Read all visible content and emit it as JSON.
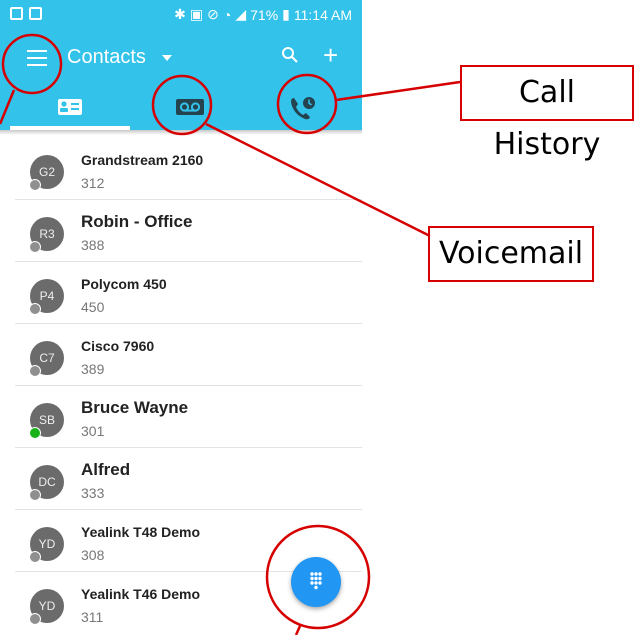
{
  "status_bar": {
    "battery": "71%",
    "time": "11:14 AM"
  },
  "app_bar": {
    "title": "Contacts",
    "menu_icon": "hamburger-menu-icon",
    "search_icon": "search-icon",
    "add_icon": "plus-icon"
  },
  "tabs": [
    {
      "icon": "contact-card-icon",
      "selected": true
    },
    {
      "icon": "voicemail-icon",
      "selected": false
    },
    {
      "icon": "call-history-icon",
      "selected": false
    }
  ],
  "contacts": [
    {
      "initials": "G2",
      "name": "Grandstream 2160",
      "ext": "312",
      "presence": "offline"
    },
    {
      "initials": "R3",
      "name": "Robin - Office",
      "ext": "388",
      "presence": "offline"
    },
    {
      "initials": "P4",
      "name": "Polycom 450",
      "ext": "450",
      "presence": "offline"
    },
    {
      "initials": "C7",
      "name": "Cisco 7960",
      "ext": "389",
      "presence": "offline"
    },
    {
      "initials": "SB",
      "name": "Bruce Wayne",
      "ext": "301",
      "presence": "online"
    },
    {
      "initials": "DC",
      "name": "Alfred",
      "ext": "333",
      "presence": "offline"
    },
    {
      "initials": "YD",
      "name": "Yealink T48 Demo",
      "ext": "308",
      "presence": "offline"
    },
    {
      "initials": "YD",
      "name": "Yealink T46 Demo",
      "ext": "311",
      "presence": "offline"
    }
  ],
  "fab": {
    "icon": "dialpad-icon"
  },
  "annotations": {
    "call_history": "Call History",
    "voicemail": "Voicemail"
  },
  "colors": {
    "primary": "#33c2ea",
    "fab": "#2196f3",
    "annotation": "#d60000",
    "online": "#16b216"
  }
}
